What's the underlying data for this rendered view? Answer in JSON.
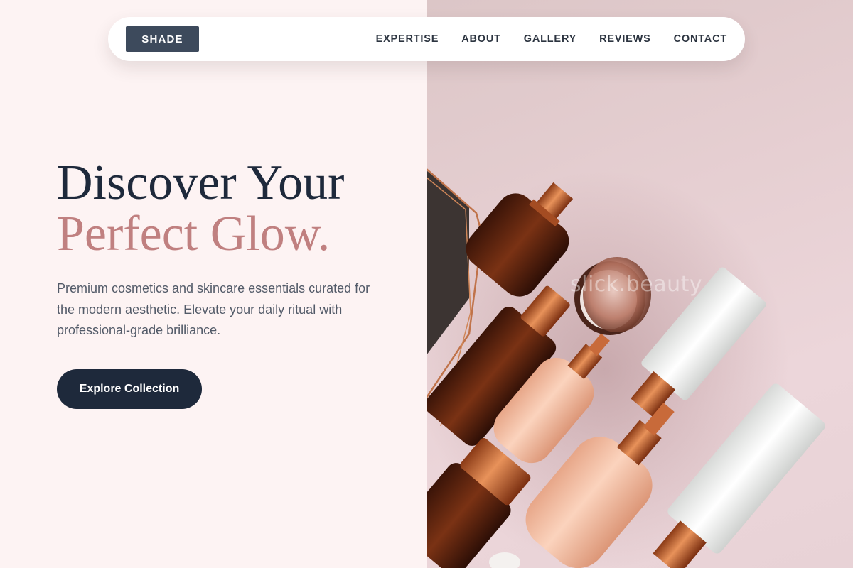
{
  "brand": {
    "logo_label": "SHADE"
  },
  "nav": {
    "links": [
      {
        "label": "EXPERTISE"
      },
      {
        "label": "ABOUT"
      },
      {
        "label": "GALLERY"
      },
      {
        "label": "REVIEWS"
      },
      {
        "label": "CONTACT"
      }
    ]
  },
  "hero": {
    "title_line_1": "Discover Your",
    "title_line_2": "Perfect Glow.",
    "description": "Premium cosmetics and skincare essentials curated for the modern aesthetic. Elevate your daily ritual with professional-grade brilliance.",
    "cta_label": "Explore Collection"
  },
  "photo": {
    "watermark": "slick.beauty",
    "subject_icons": [
      "amber-glass-bottle-icon",
      "rose-gold-compact-icon",
      "peach-pump-bottle-icon",
      "white-tube-icon",
      "copper-wire-frame-icon"
    ]
  },
  "colors": {
    "background_left": "#fdf3f3",
    "navy": "#1e293b",
    "slate_logo": "#3d4a5c",
    "rose_accent": "#c08080",
    "copper": "#c86a3a"
  }
}
